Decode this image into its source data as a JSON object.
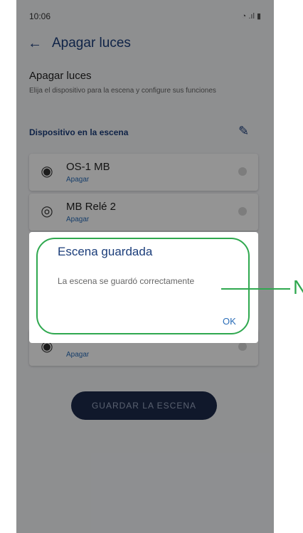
{
  "status": {
    "time": "10:06",
    "icons": "◔ .ıl ▮"
  },
  "appbar": {
    "back": "←",
    "title": "Apagar luces"
  },
  "section": {
    "title": "Apagar luces",
    "subtitle": "Elija el dispositivo para la escena y configure sus funciones"
  },
  "devices": {
    "header": "Dispositivo en la escena",
    "edit_icon": "✎",
    "items": [
      {
        "name": "OS-1 MB",
        "action": "Apagar",
        "icon": "◉"
      },
      {
        "name": "MB Relé 2",
        "action": "Apagar",
        "icon": "◎"
      },
      {
        "name": "",
        "action": "Apagar",
        "icon": "◉"
      }
    ]
  },
  "save_button": "GUARDAR LA ESCENA",
  "dialog": {
    "title": "Escena guardada",
    "message": "La escena se guardó correctamente",
    "ok": "OK"
  },
  "callout": {
    "label": "N",
    "color": "#2fa84f"
  }
}
